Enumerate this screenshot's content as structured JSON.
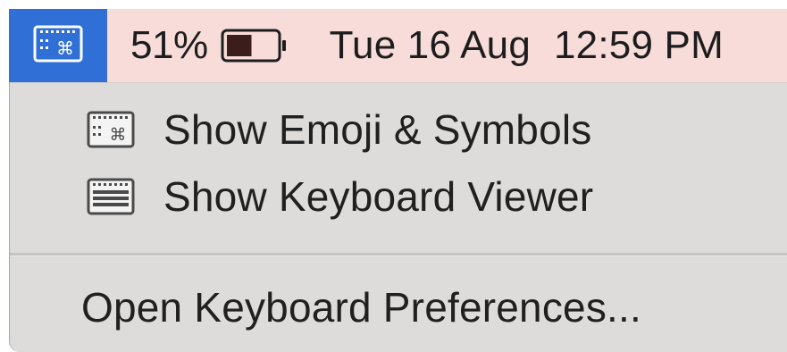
{
  "menubar": {
    "input_menu_icon": "keyboard-command-icon",
    "battery_percent": "51%",
    "battery_level": 0.51,
    "battery_icon": "battery-icon",
    "date": "Tue 16 Aug",
    "time": "12:59 PM",
    "accent_color": "#2f6fd6",
    "bar_color": "#f7dcd9"
  },
  "menu": {
    "items": [
      {
        "label": "Show Emoji & Symbols",
        "icon": "emoji-symbols-icon"
      },
      {
        "label": "Show Keyboard Viewer",
        "icon": "keyboard-viewer-icon"
      }
    ],
    "preferences_label": "Open Keyboard Preferences..."
  }
}
